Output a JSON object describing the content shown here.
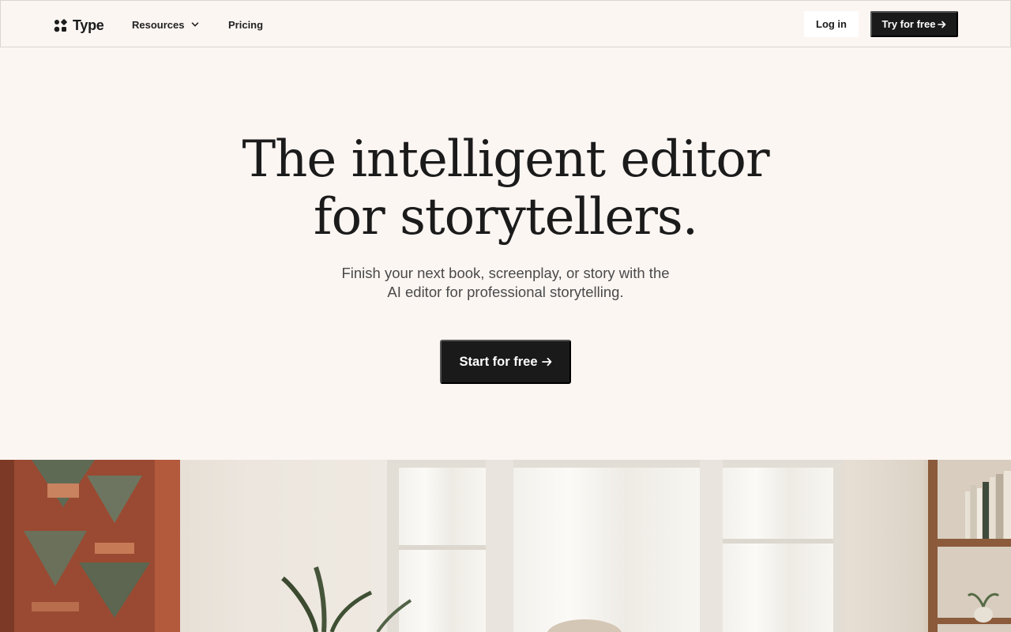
{
  "nav": {
    "brand": "Type",
    "links": [
      {
        "label": "Resources",
        "has_dropdown": true
      },
      {
        "label": "Pricing"
      }
    ],
    "login_label": "Log in",
    "cta_label": "Try for free",
    "cta_icon": "arrow-right-icon"
  },
  "hero": {
    "title_line1": "The intelligent editor",
    "title_line2": "for storytellers.",
    "subtitle_line1": "Finish your next book, screenplay, or story with the",
    "subtitle_line2": "AI editor for professional storytelling.",
    "cta_label": "Start for free",
    "cta_icon": "arrow-right-icon"
  },
  "colors": {
    "background": "#fcf6f3",
    "primary_button": "#1a1a1a",
    "text": "#1b1b1b"
  }
}
